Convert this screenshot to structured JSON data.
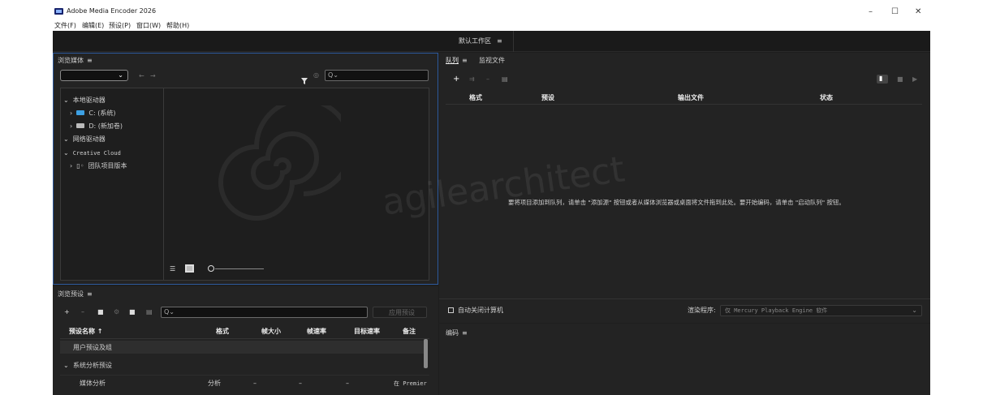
{
  "window": {
    "title": "Adobe Media Encoder 2026",
    "minimize": "–",
    "maximize": "☐",
    "close": "✕"
  },
  "menubar": [
    "文件(F)",
    "编辑(E)",
    "预设(P)",
    "窗口(W)",
    "帮助(H)"
  ],
  "workspace": {
    "label": "默认工作区",
    "menu": "≡"
  },
  "media_browser": {
    "title": "浏览媒体",
    "menu": "≡",
    "filter_icon": "filter-icon",
    "search_placeholder": "",
    "tree": [
      {
        "label": "本地驱动器",
        "expanded": true,
        "level": 0
      },
      {
        "label": "C: (系统)",
        "expanded": false,
        "level": 1,
        "icon": "drive-c-icon"
      },
      {
        "label": "D: (新加卷)",
        "expanded": false,
        "level": 1,
        "icon": "drive-d-icon"
      },
      {
        "label": "网络驱动器",
        "expanded": true,
        "level": 0
      },
      {
        "label": "Creative Cloud",
        "expanded": true,
        "level": 0
      },
      {
        "label": "团队项目版本",
        "expanded": false,
        "level": 1,
        "icon": "team-project-icon"
      }
    ]
  },
  "preset_browser": {
    "title": "浏览预设",
    "menu": "≡",
    "apply_label": "应用预设",
    "columns": [
      "预设名称 ↑",
      "格式",
      "帧大小",
      "帧速率",
      "目标速率",
      "备注"
    ],
    "rows": [
      {
        "name": "用户预设及组",
        "selected": true,
        "cells": []
      },
      {
        "name": "系统分析预设",
        "group": true,
        "cells": []
      },
      {
        "name": "媒体分析",
        "cells": [
          "分析",
          "–",
          "–",
          "–",
          "在 Premier"
        ]
      }
    ]
  },
  "queue": {
    "tab_queue": "队列",
    "tab_menu": "≡",
    "tab_watch": "监视文件",
    "columns": [
      "格式",
      "预设",
      "输出文件",
      "状态"
    ],
    "empty_message": "要将项目添加到队列，请单击 \"添加源\" 按钮或者从媒体浏览器或桌面将文件拖到此处。要开始编码，请单击 \"启动队列\" 按钮。",
    "auto_shutdown_label": "自动关闭计算机",
    "renderer_label": "渲染程序:",
    "renderer_value": "仅 Mercury Playback Engine 软件"
  },
  "encoding": {
    "title": "编码",
    "menu": "≡"
  },
  "watermark": "agilearchitect",
  "colors": {
    "accent": "#2d5a9e",
    "panel": "#232323",
    "background": "#1e1e1e",
    "text": "#cfcfcf"
  }
}
